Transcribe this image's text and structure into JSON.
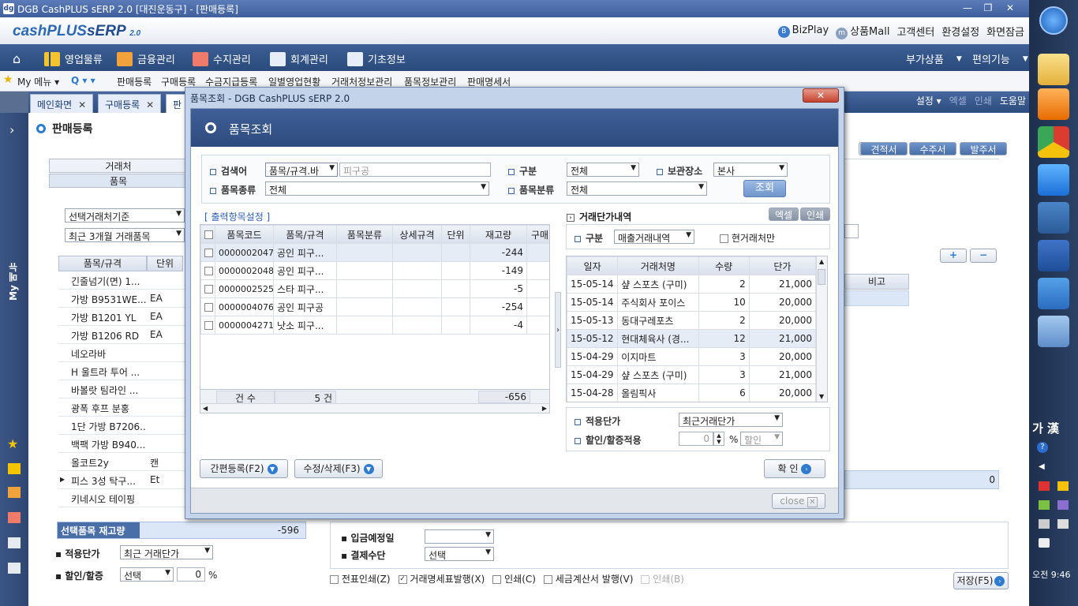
{
  "window": {
    "title": "DGB CashPLUS sERP 2.0 [대진운동구] - [판매등록]",
    "min": "—",
    "max": "❐",
    "close": "✕"
  },
  "logo": {
    "main": "cashPLUS",
    "erp": "sERP",
    "ver": "2.0"
  },
  "toplinks": [
    "BizPlay",
    "상품Mall",
    "고객센터",
    "환경설정",
    "화면잠금"
  ],
  "mainmenu": {
    "items": [
      "영업물류",
      "금융관리",
      "수지관리",
      "회계관리",
      "기초정보"
    ],
    "right": [
      "부가상품",
      "편의기능"
    ]
  },
  "shortcut": {
    "my": "My 메뉴",
    "items": [
      "판매등록",
      "구매등록",
      "수금지급등록",
      "일별영업현황",
      "거래처정보관리",
      "품목정보관리",
      "판매명세서"
    ]
  },
  "tabs": {
    "items": [
      "메인화면",
      "구매등록",
      "판"
    ],
    "right": [
      "설정",
      "엑셀",
      "인쇄",
      "도움말"
    ]
  },
  "page": {
    "title": "판매등록",
    "mymenu": "My 메뉴"
  },
  "bg": {
    "tab1": "거래처",
    "tab2": "품목",
    "filter1": "선택거래처기준",
    "filter2": "최근 3개월 거래품목",
    "col_item": "품목/규격",
    "col_unit": "단위",
    "items": [
      {
        "name": "긴줄넘기(면) 1...",
        "unit": ""
      },
      {
        "name": "가방 B9531WE...",
        "unit": "EA"
      },
      {
        "name": "가방 B1201 YL",
        "unit": "EA"
      },
      {
        "name": "가방 B1206 RD",
        "unit": "EA"
      },
      {
        "name": "네오라바",
        "unit": ""
      },
      {
        "name": "H 울트라 투어 ...",
        "unit": ""
      },
      {
        "name": "바볼랏 팀라인 ...",
        "unit": ""
      },
      {
        "name": "광폭 후프 분홍",
        "unit": ""
      },
      {
        "name": "1단 가방 B7206...",
        "unit": ""
      },
      {
        "name": "백팩 가방 B940...",
        "unit": ""
      },
      {
        "name": "올코트2y",
        "unit": "캔"
      },
      {
        "name": "피스 3성 탁구...",
        "unit": "Et"
      },
      {
        "name": "키네시오 테이핑",
        "unit": ""
      }
    ],
    "stock_label": "선택품목 재고량",
    "stock_value": "-596",
    "apply_price_label": "적용단가",
    "apply_price_value": "최근 거래단가",
    "discount_label": "할인/할증",
    "discount_value": "선택",
    "discount_pct": "0",
    "pct": "%",
    "doc_buttons": [
      "견적서",
      "수주서",
      "발주서"
    ],
    "remark": "비고",
    "plus": "+",
    "minus": "−",
    "total_right": "0",
    "due_label": "입금예정일",
    "pay_label": "결제수단",
    "pay_value": "선택",
    "print_opts": [
      "전표인쇄(Z)",
      "거래명세표발행(X)",
      "인쇄(C)",
      "세금계산서 발행(V)",
      "인쇄(B)"
    ],
    "save": "저장(F5)"
  },
  "modal": {
    "title": "품목조회 - DGB CashPLUS sERP 2.0",
    "close_x": "✕",
    "header": "품목조회",
    "search_label": "검색어",
    "search_field": "품목/규격.바",
    "search_placeholder": "피구공",
    "type_label": "구분",
    "type_value": "전체",
    "store_label": "보관장소",
    "store_value": "본사",
    "kind_label": "품목종류",
    "kind_value": "전체",
    "class_label": "품목분류",
    "class_value": "전체",
    "search_btn": "조회",
    "output_setting": "[ 출력항목설정 ]",
    "left_cols": [
      "품목코드",
      "품목/규격",
      "품목분류",
      "상세규격",
      "단위",
      "재고량",
      "구매"
    ],
    "left_rows": [
      {
        "code": "0000002047",
        "name": "공인 피구...",
        "stock": "-244"
      },
      {
        "code": "0000002048",
        "name": "공인 피구...",
        "stock": "-149"
      },
      {
        "code": "0000002525",
        "name": "스타 피구...",
        "stock": "-5"
      },
      {
        "code": "0000004076",
        "name": "공인 피구공",
        "stock": "-254"
      },
      {
        "code": "0000004271",
        "name": "낫소 피구...",
        "stock": "-4"
      }
    ],
    "footer_count_label": "건 수",
    "footer_count": "5 건",
    "footer_stock": "-656",
    "right_title": "거래단가내역",
    "right_excel": "엑셀",
    "right_print": "인쇄",
    "right_type_label": "구분",
    "right_type_value": "매출거래내역",
    "current_only": "현거래처만",
    "right_cols": [
      "일자",
      "거래처명",
      "수량",
      "단가"
    ],
    "right_rows": [
      {
        "date": "15-05-14",
        "cust": "샾 스포츠 (구미)",
        "qty": "2",
        "price": "21,000"
      },
      {
        "date": "15-05-14",
        "cust": "주식회사 포이스",
        "qty": "10",
        "price": "20,000"
      },
      {
        "date": "15-05-13",
        "cust": "동대구레포츠",
        "qty": "2",
        "price": "20,000"
      },
      {
        "date": "15-05-12",
        "cust": "현대체육사 (경...",
        "qty": "12",
        "price": "21,000"
      },
      {
        "date": "15-04-29",
        "cust": "이지마트",
        "qty": "3",
        "price": "20,000"
      },
      {
        "date": "15-04-29",
        "cust": "샾 스포츠 (구미)",
        "qty": "3",
        "price": "21,000"
      },
      {
        "date": "15-04-28",
        "cust": "올림픽사",
        "qty": "6",
        "price": "20,000"
      }
    ],
    "apply_label": "적용단가",
    "apply_value": "최근거래단가",
    "disc_label": "할인/할증적용",
    "disc_value": "0",
    "disc_pct": "%",
    "disc_type": "할인",
    "btn_quick": "간편등록(F2)",
    "btn_edit": "수정/삭제(F3)",
    "btn_ok": "확 인",
    "close_btn": "close"
  },
  "taskbar": {
    "ime": "가 漢",
    "clock": "오전 9:46"
  }
}
